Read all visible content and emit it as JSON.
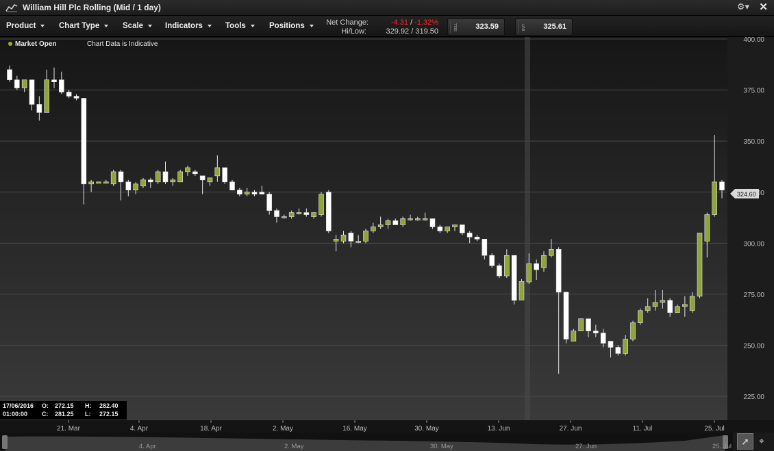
{
  "window": {
    "title": "William Hill Plc Rolling (Mid / 1 day)"
  },
  "menu": [
    {
      "label": "Product"
    },
    {
      "label": "Chart Type"
    },
    {
      "label": "Scale"
    },
    {
      "label": "Indicators"
    },
    {
      "label": "Tools"
    },
    {
      "label": "Positions"
    }
  ],
  "quote": {
    "net_change_label": "Net Change:",
    "net_change_value": "-4.31",
    "net_change_sep": "/",
    "net_change_pct": "-1.32%",
    "hilow_label": "Hi/Low:",
    "hilow_value": "329.92 / 319.50",
    "sell_tag": "SELL",
    "sell_price": "323.59",
    "buy_tag": "BUY",
    "buy_price": "325.61",
    "colors": {
      "negative": "#ff2a2a",
      "up_candle": "#8fa53a",
      "down_candle": "#ffffff"
    }
  },
  "status": {
    "market": "Market Open",
    "indicative": "Chart Data is Indicative"
  },
  "crosshair": {
    "date": "17/06/2016",
    "time": "01:00:00",
    "o_label": "O:",
    "o_value": "272.15",
    "h_label": "H:",
    "h_value": "282.40",
    "c_label": "C:",
    "c_value": "281.25",
    "l_label": "L:",
    "l_value": "272.15"
  },
  "price_marker": "324.60",
  "navigator_labels": [
    "4. Apr",
    "2. May",
    "30. May",
    "27. Jun",
    "25. Jul"
  ],
  "chart_data": {
    "type": "candlestick",
    "y_axis": {
      "min": 219,
      "max": 400,
      "ticks": [
        225,
        250,
        275,
        300,
        325,
        350,
        375,
        400
      ],
      "tick_labels": [
        "225.00",
        "250.00",
        "275.00",
        "300.00",
        "325.00",
        "350.00",
        "375.00",
        "400.00"
      ],
      "side": "right"
    },
    "x_axis": {
      "labels": [
        "21. Mar",
        "4. Apr",
        "18. Apr",
        "2. May",
        "16. May",
        "30. May",
        "13. Jun",
        "27. Jun",
        "11. Jul",
        "25. Jul"
      ]
    },
    "grid": true,
    "candles": [
      {
        "o": 385,
        "h": 387,
        "l": 379,
        "c": 380
      },
      {
        "o": 380,
        "h": 382,
        "l": 375,
        "c": 376
      },
      {
        "o": 376,
        "h": 380,
        "l": 374,
        "c": 380
      },
      {
        "o": 380,
        "h": 380,
        "l": 365,
        "c": 368
      },
      {
        "o": 368,
        "h": 372,
        "l": 360,
        "c": 364
      },
      {
        "o": 364,
        "h": 385,
        "l": 364,
        "c": 380
      },
      {
        "o": 380,
        "h": 386,
        "l": 376,
        "c": 379
      },
      {
        "o": 380,
        "h": 384,
        "l": 373,
        "c": 374
      },
      {
        "o": 374,
        "h": 375,
        "l": 371,
        "c": 372
      },
      {
        "o": 372,
        "h": 373,
        "l": 370,
        "c": 371
      },
      {
        "o": 371,
        "h": 371,
        "l": 319,
        "c": 329
      },
      {
        "o": 329,
        "h": 331,
        "l": 325,
        "c": 330
      },
      {
        "o": 330,
        "h": 330,
        "l": 330,
        "c": 330
      },
      {
        "o": 330,
        "h": 331,
        "l": 330,
        "c": 330
      },
      {
        "o": 329,
        "h": 336,
        "l": 328,
        "c": 335
      },
      {
        "o": 335,
        "h": 336,
        "l": 321,
        "c": 330
      },
      {
        "o": 330,
        "h": 331,
        "l": 323,
        "c": 326
      },
      {
        "o": 326,
        "h": 330,
        "l": 324,
        "c": 329
      },
      {
        "o": 328,
        "h": 332,
        "l": 327,
        "c": 331
      },
      {
        "o": 331,
        "h": 332,
        "l": 327,
        "c": 330
      },
      {
        "o": 330,
        "h": 336,
        "l": 329,
        "c": 335
      },
      {
        "o": 335,
        "h": 340,
        "l": 329,
        "c": 330
      },
      {
        "o": 330,
        "h": 332,
        "l": 328,
        "c": 331
      },
      {
        "o": 330,
        "h": 336,
        "l": 330,
        "c": 335
      },
      {
        "o": 335,
        "h": 338,
        "l": 333,
        "c": 337
      },
      {
        "o": 335,
        "h": 336,
        "l": 333,
        "c": 334
      },
      {
        "o": 333,
        "h": 333,
        "l": 324,
        "c": 331
      },
      {
        "o": 330,
        "h": 332,
        "l": 328,
        "c": 332
      },
      {
        "o": 333,
        "h": 343,
        "l": 330,
        "c": 337
      },
      {
        "o": 337,
        "h": 337,
        "l": 329,
        "c": 330
      },
      {
        "o": 330,
        "h": 331,
        "l": 326,
        "c": 326
      },
      {
        "o": 326,
        "h": 327,
        "l": 323,
        "c": 324
      },
      {
        "o": 324,
        "h": 327,
        "l": 323,
        "c": 325
      },
      {
        "o": 325,
        "h": 326,
        "l": 323,
        "c": 324
      },
      {
        "o": 325,
        "h": 328,
        "l": 324,
        "c": 324
      },
      {
        "o": 324,
        "h": 325,
        "l": 314,
        "c": 316
      },
      {
        "o": 316,
        "h": 317,
        "l": 310,
        "c": 313
      },
      {
        "o": 313,
        "h": 314,
        "l": 312,
        "c": 313
      },
      {
        "o": 313,
        "h": 316,
        "l": 312,
        "c": 315
      },
      {
        "o": 315,
        "h": 317,
        "l": 314,
        "c": 315
      },
      {
        "o": 315,
        "h": 317,
        "l": 313,
        "c": 314
      },
      {
        "o": 313,
        "h": 315,
        "l": 312,
        "c": 315
      },
      {
        "o": 314,
        "h": 325,
        "l": 313,
        "c": 324
      },
      {
        "o": 325,
        "h": 326,
        "l": 305,
        "c": 306
      },
      {
        "o": 301,
        "h": 304,
        "l": 296,
        "c": 302
      },
      {
        "o": 301,
        "h": 306,
        "l": 300,
        "c": 304
      },
      {
        "o": 305,
        "h": 306,
        "l": 298,
        "c": 301
      },
      {
        "o": 301,
        "h": 304,
        "l": 300,
        "c": 301
      },
      {
        "o": 301,
        "h": 307,
        "l": 300,
        "c": 306
      },
      {
        "o": 306,
        "h": 310,
        "l": 305,
        "c": 308
      },
      {
        "o": 308,
        "h": 313,
        "l": 307,
        "c": 309
      },
      {
        "o": 309,
        "h": 312,
        "l": 307,
        "c": 311
      },
      {
        "o": 311,
        "h": 312,
        "l": 309,
        "c": 309
      },
      {
        "o": 309,
        "h": 313,
        "l": 308,
        "c": 312
      },
      {
        "o": 312,
        "h": 314,
        "l": 311,
        "c": 312
      },
      {
        "o": 312,
        "h": 313,
        "l": 311,
        "c": 312
      },
      {
        "o": 312,
        "h": 315,
        "l": 311,
        "c": 312
      },
      {
        "o": 312,
        "h": 312,
        "l": 307,
        "c": 308
      },
      {
        "o": 308,
        "h": 309,
        "l": 305,
        "c": 306
      },
      {
        "o": 306,
        "h": 308,
        "l": 305,
        "c": 308
      },
      {
        "o": 308,
        "h": 309,
        "l": 306,
        "c": 309
      },
      {
        "o": 309,
        "h": 309,
        "l": 304,
        "c": 305
      },
      {
        "o": 305,
        "h": 306,
        "l": 300,
        "c": 303
      },
      {
        "o": 303,
        "h": 304,
        "l": 301,
        "c": 302
      },
      {
        "o": 302,
        "h": 302,
        "l": 292,
        "c": 294
      },
      {
        "o": 294,
        "h": 295,
        "l": 288,
        "c": 289
      },
      {
        "o": 289,
        "h": 290,
        "l": 283,
        "c": 284
      },
      {
        "o": 284,
        "h": 297,
        "l": 283,
        "c": 294
      },
      {
        "o": 294,
        "h": 294,
        "l": 270,
        "c": 272
      },
      {
        "o": 272.15,
        "h": 282.4,
        "l": 272.15,
        "c": 281.25
      },
      {
        "o": 281,
        "h": 295,
        "l": 280,
        "c": 290
      },
      {
        "o": 290,
        "h": 292,
        "l": 282,
        "c": 287
      },
      {
        "o": 288,
        "h": 296,
        "l": 286,
        "c": 294
      },
      {
        "o": 294,
        "h": 302,
        "l": 293,
        "c": 297
      },
      {
        "o": 297,
        "h": 298,
        "l": 236,
        "c": 276
      },
      {
        "o": 276,
        "h": 276,
        "l": 251,
        "c": 253
      },
      {
        "o": 252,
        "h": 258,
        "l": 252,
        "c": 257
      },
      {
        "o": 257,
        "h": 263,
        "l": 257,
        "c": 263
      },
      {
        "o": 263,
        "h": 263,
        "l": 254,
        "c": 257
      },
      {
        "o": 257,
        "h": 260,
        "l": 254,
        "c": 256
      },
      {
        "o": 256,
        "h": 258,
        "l": 249,
        "c": 251
      },
      {
        "o": 252,
        "h": 252,
        "l": 244,
        "c": 249
      },
      {
        "o": 249,
        "h": 250,
        "l": 245,
        "c": 246
      },
      {
        "o": 246,
        "h": 255,
        "l": 245,
        "c": 253
      },
      {
        "o": 253,
        "h": 262,
        "l": 252,
        "c": 261
      },
      {
        "o": 261,
        "h": 268,
        "l": 260,
        "c": 267
      },
      {
        "o": 267,
        "h": 273,
        "l": 266,
        "c": 269
      },
      {
        "o": 269,
        "h": 277,
        "l": 267,
        "c": 271
      },
      {
        "o": 271,
        "h": 277,
        "l": 268,
        "c": 272
      },
      {
        "o": 272,
        "h": 273,
        "l": 264,
        "c": 266
      },
      {
        "o": 266,
        "h": 270,
        "l": 266,
        "c": 269
      },
      {
        "o": 269,
        "h": 274,
        "l": 264,
        "c": 270
      },
      {
        "o": 267,
        "h": 276,
        "l": 266,
        "c": 274
      },
      {
        "o": 274,
        "h": 305,
        "l": 273,
        "c": 305
      },
      {
        "o": 301,
        "h": 315,
        "l": 293,
        "c": 314
      },
      {
        "o": 314,
        "h": 353,
        "l": 313,
        "c": 330
      },
      {
        "o": 330,
        "h": 331,
        "l": 322,
        "c": 326
      }
    ]
  }
}
